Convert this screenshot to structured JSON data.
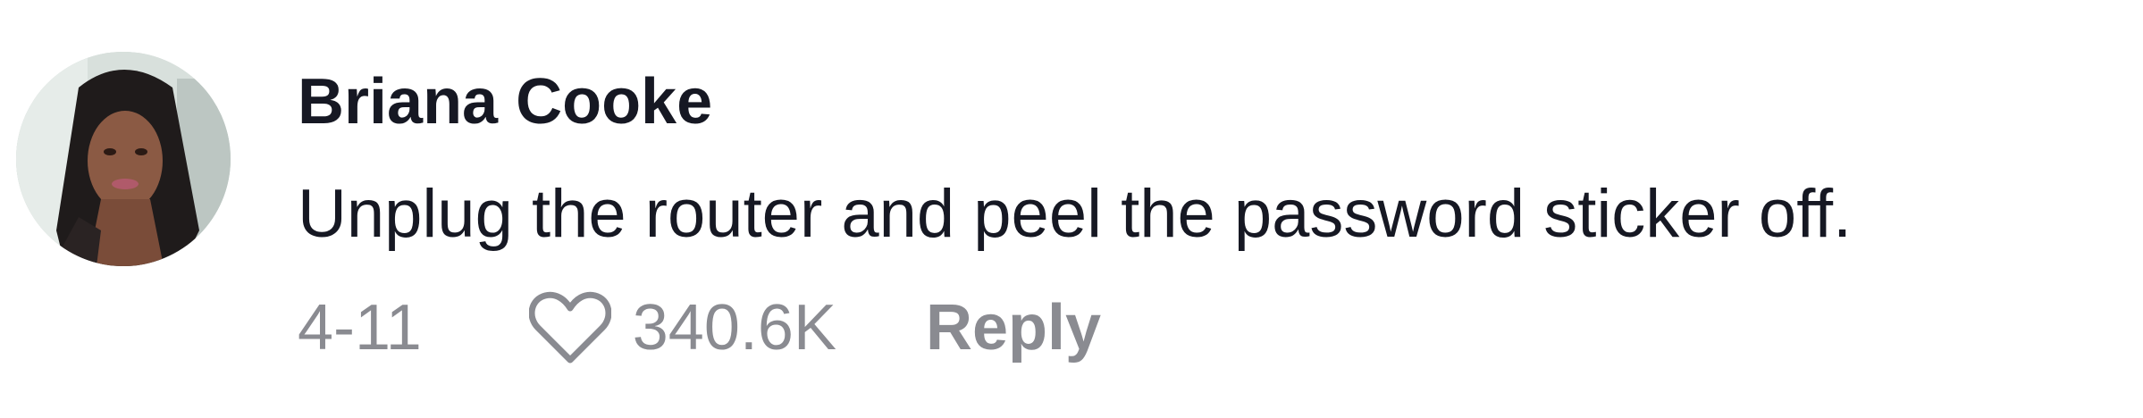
{
  "comment": {
    "author": "Briana Cooke",
    "text": "Unplug the router and peel the password sticker off.",
    "date": "4-11",
    "likes": "340.6K",
    "reply_label": "Reply",
    "avatar_icon": "user-avatar-photo",
    "like_icon": "heart-outline-icon"
  },
  "colors": {
    "text_primary": "#161823",
    "text_secondary": "#8a8b91",
    "background": "#ffffff"
  }
}
